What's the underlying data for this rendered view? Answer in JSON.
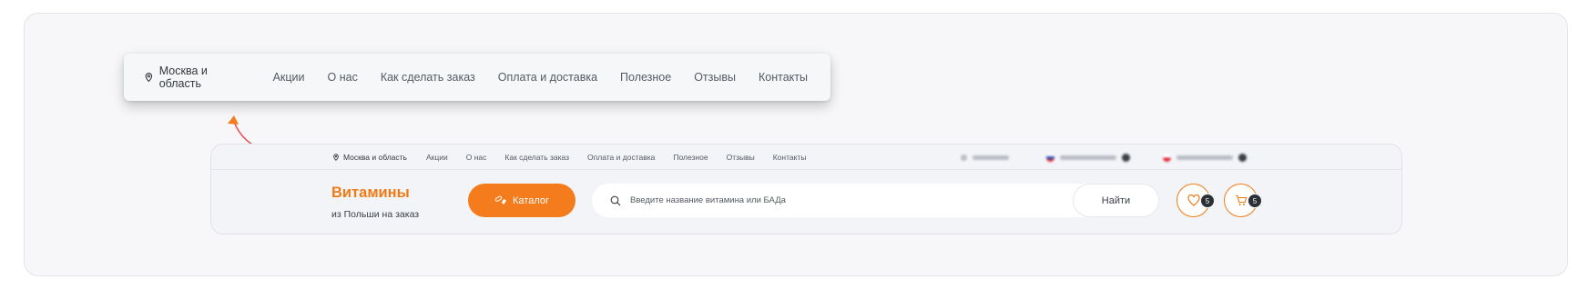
{
  "zoom_nav": {
    "location": "Москва и область",
    "links": [
      "Акции",
      "О нас",
      "Как сделать заказ",
      "Оплата и доставка",
      "Полезное",
      "Отзывы",
      "Контакты"
    ]
  },
  "site": {
    "topbar": {
      "location": "Москва и область",
      "links": [
        "Акции",
        "О нас",
        "Как сделать заказ",
        "Оплата и доставка",
        "Полезное",
        "Отзывы",
        "Контакты"
      ]
    },
    "brand": {
      "name": "Витамины",
      "subtitle": "из Польши на заказ"
    },
    "catalog_label": "Каталог",
    "search": {
      "placeholder": "Введите название витамина или БАДа",
      "button": "Найти"
    },
    "favorites_count": "5",
    "cart_count": "5"
  },
  "colors": {
    "accent": "#f47c1c",
    "arrow": "#e8505b",
    "badge": "#2b2f36"
  }
}
